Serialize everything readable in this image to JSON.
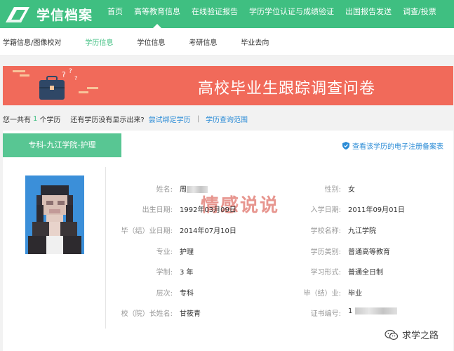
{
  "topnav": {
    "logo_text": "学信档案",
    "items": [
      {
        "label": "首页"
      },
      {
        "label": "高等教育信息",
        "active": true
      },
      {
        "label": "在线验证报告"
      },
      {
        "label": "学历学位认证与成绩验证"
      },
      {
        "label": "出国报告发送"
      },
      {
        "label": "调查/投票"
      }
    ]
  },
  "subnav": {
    "items": [
      {
        "label": "学籍信息/图像校对"
      },
      {
        "label": "学历信息",
        "active": true
      },
      {
        "label": "学位信息"
      },
      {
        "label": "考研信息"
      },
      {
        "label": "毕业去向"
      }
    ]
  },
  "banner": {
    "title": "高校毕业生跟踪调查问卷"
  },
  "info": {
    "prefix": "您一共有",
    "count": "1",
    "suffix": "个学历",
    "question": "还有学历没有显示出来?",
    "bind_link": "尝试绑定学历",
    "separator": "|",
    "query_link": "学历查询范围"
  },
  "record": {
    "tab_label": "专科-九江学院-护理",
    "register_link": "查看该学历的电子注册备案表",
    "stamp": "情感说说",
    "fields_left": [
      {
        "label": "姓名:",
        "value": "周"
      },
      {
        "label": "出生日期:",
        "value": "1992年03月09日"
      },
      {
        "label": "毕（结）业日期:",
        "value": "2014年07月10日"
      },
      {
        "label": "专业:",
        "value": "护理"
      },
      {
        "label": "学制:",
        "value": "3 年"
      },
      {
        "label": "层次:",
        "value": "专科"
      },
      {
        "label": "校（院）长姓名:",
        "value": "甘筱青"
      }
    ],
    "fields_right": [
      {
        "label": "性别:",
        "value": "女"
      },
      {
        "label": "入学日期:",
        "value": "2011年09月01日"
      },
      {
        "label": "学校名称:",
        "value": "九江学院"
      },
      {
        "label": "学历类别:",
        "value": "普通高等教育"
      },
      {
        "label": "学习形式:",
        "value": "普通全日制"
      },
      {
        "label": "毕（结）业:",
        "value": "毕业"
      },
      {
        "label": "证书编号:",
        "value": "1"
      }
    ]
  },
  "watermark": {
    "text": "求学之路"
  },
  "colors": {
    "nav_green": "#3fbf81",
    "tab_green": "#58c693",
    "banner_red": "#f16a5a",
    "link_blue": "#2a8bd6"
  }
}
